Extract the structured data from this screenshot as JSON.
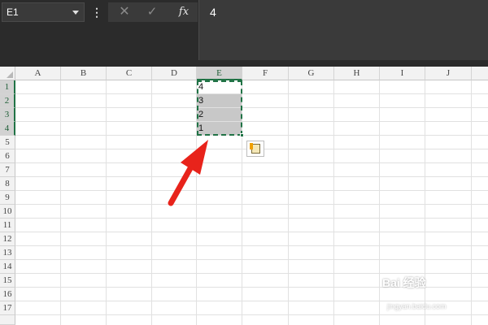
{
  "formula_bar": {
    "name_box_value": "E1",
    "menu_label": "⋮",
    "cancel_label": "✕",
    "enter_label": "✓",
    "fx_label": "fx",
    "formula_value": "4"
  },
  "sheet": {
    "columns": [
      "A",
      "B",
      "C",
      "D",
      "E",
      "F",
      "G",
      "H",
      "I",
      "J"
    ],
    "rows": [
      "1",
      "2",
      "3",
      "4",
      "5",
      "6",
      "7",
      "8",
      "9",
      "10",
      "11",
      "12",
      "13",
      "14",
      "15",
      "16",
      "17"
    ],
    "selected_column": "E",
    "selected_rows": [
      "1",
      "2",
      "3",
      "4"
    ],
    "cells": {
      "E1": "4",
      "E2": "3",
      "E3": "2",
      "E4": "1"
    }
  },
  "colors": {
    "selection_accent": "#217346",
    "arrow": "#e8231b",
    "toolbar_bg": "#2b2b2b"
  },
  "icons": {
    "paste_options": "paste-options-icon"
  },
  "watermark": {
    "text": "Bai 经验",
    "sub": "jingyan.baidu.com"
  }
}
